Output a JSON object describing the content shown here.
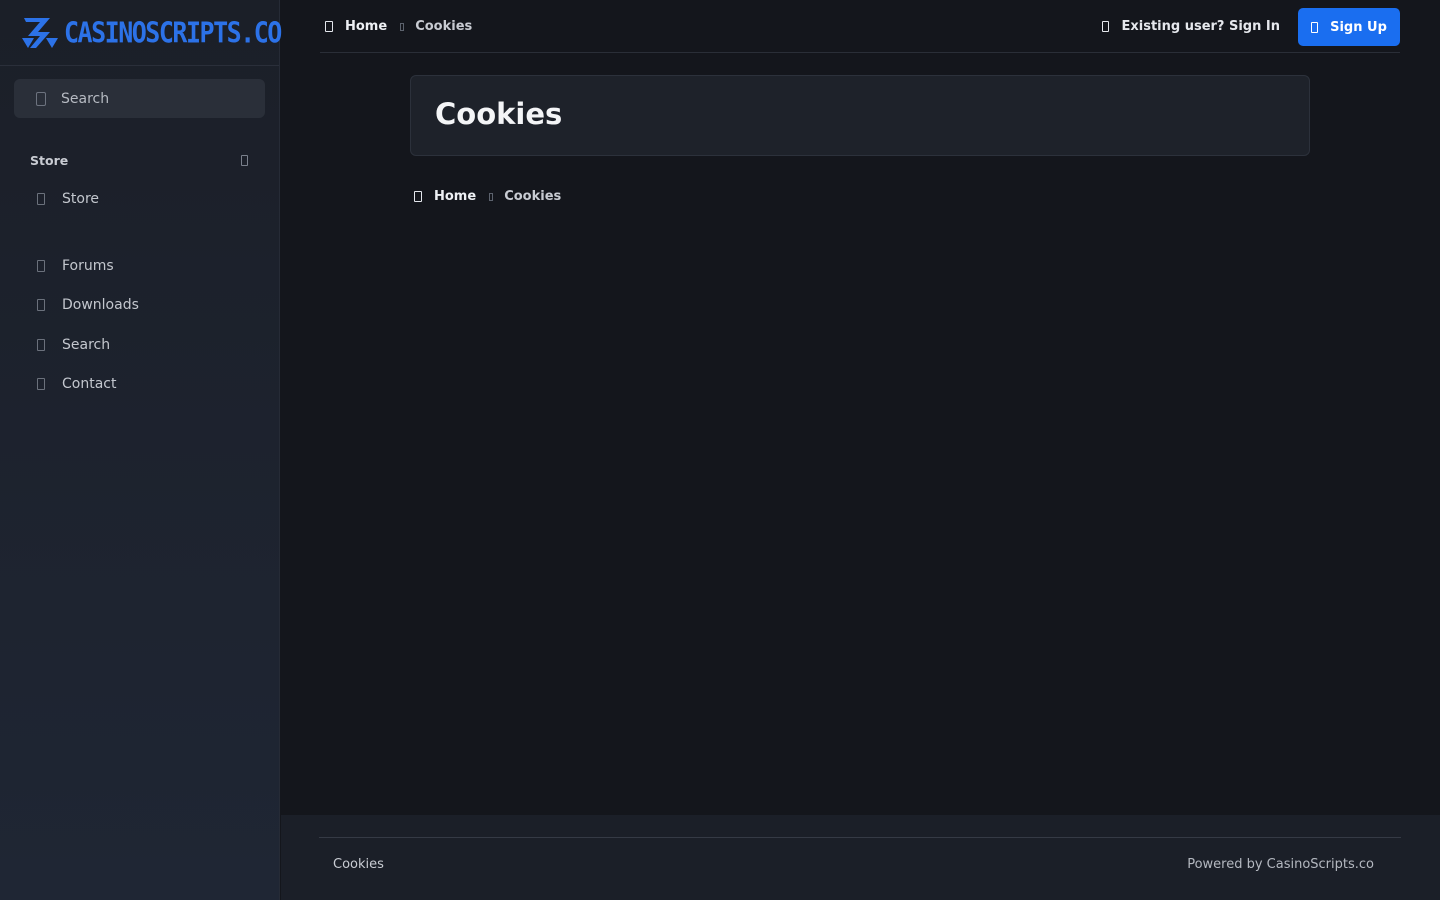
{
  "brand": {
    "logo_text": "CASINOSCRIPTS.CO",
    "accent": "#1a6ef0"
  },
  "sidebar": {
    "search_label": "Search",
    "section_title": "Store",
    "store_items": [
      {
        "label": "Store",
        "icon": "store-icon"
      }
    ],
    "items": [
      {
        "label": "Forums",
        "icon": "forums-icon"
      },
      {
        "label": "Downloads",
        "icon": "downloads-icon"
      },
      {
        "label": "Search",
        "icon": "search-icon"
      },
      {
        "label": "Contact",
        "icon": "contact-icon"
      }
    ]
  },
  "header": {
    "breadcrumb_home": "Home",
    "breadcrumb_current": "Cookies",
    "signin_label": "Existing user? Sign In",
    "signup_label": "Sign Up"
  },
  "main": {
    "title": "Cookies",
    "breadcrumb_home": "Home",
    "breadcrumb_current": "Cookies"
  },
  "footer": {
    "link": "Cookies",
    "powered_by": "Powered by CasinoScripts.co"
  }
}
